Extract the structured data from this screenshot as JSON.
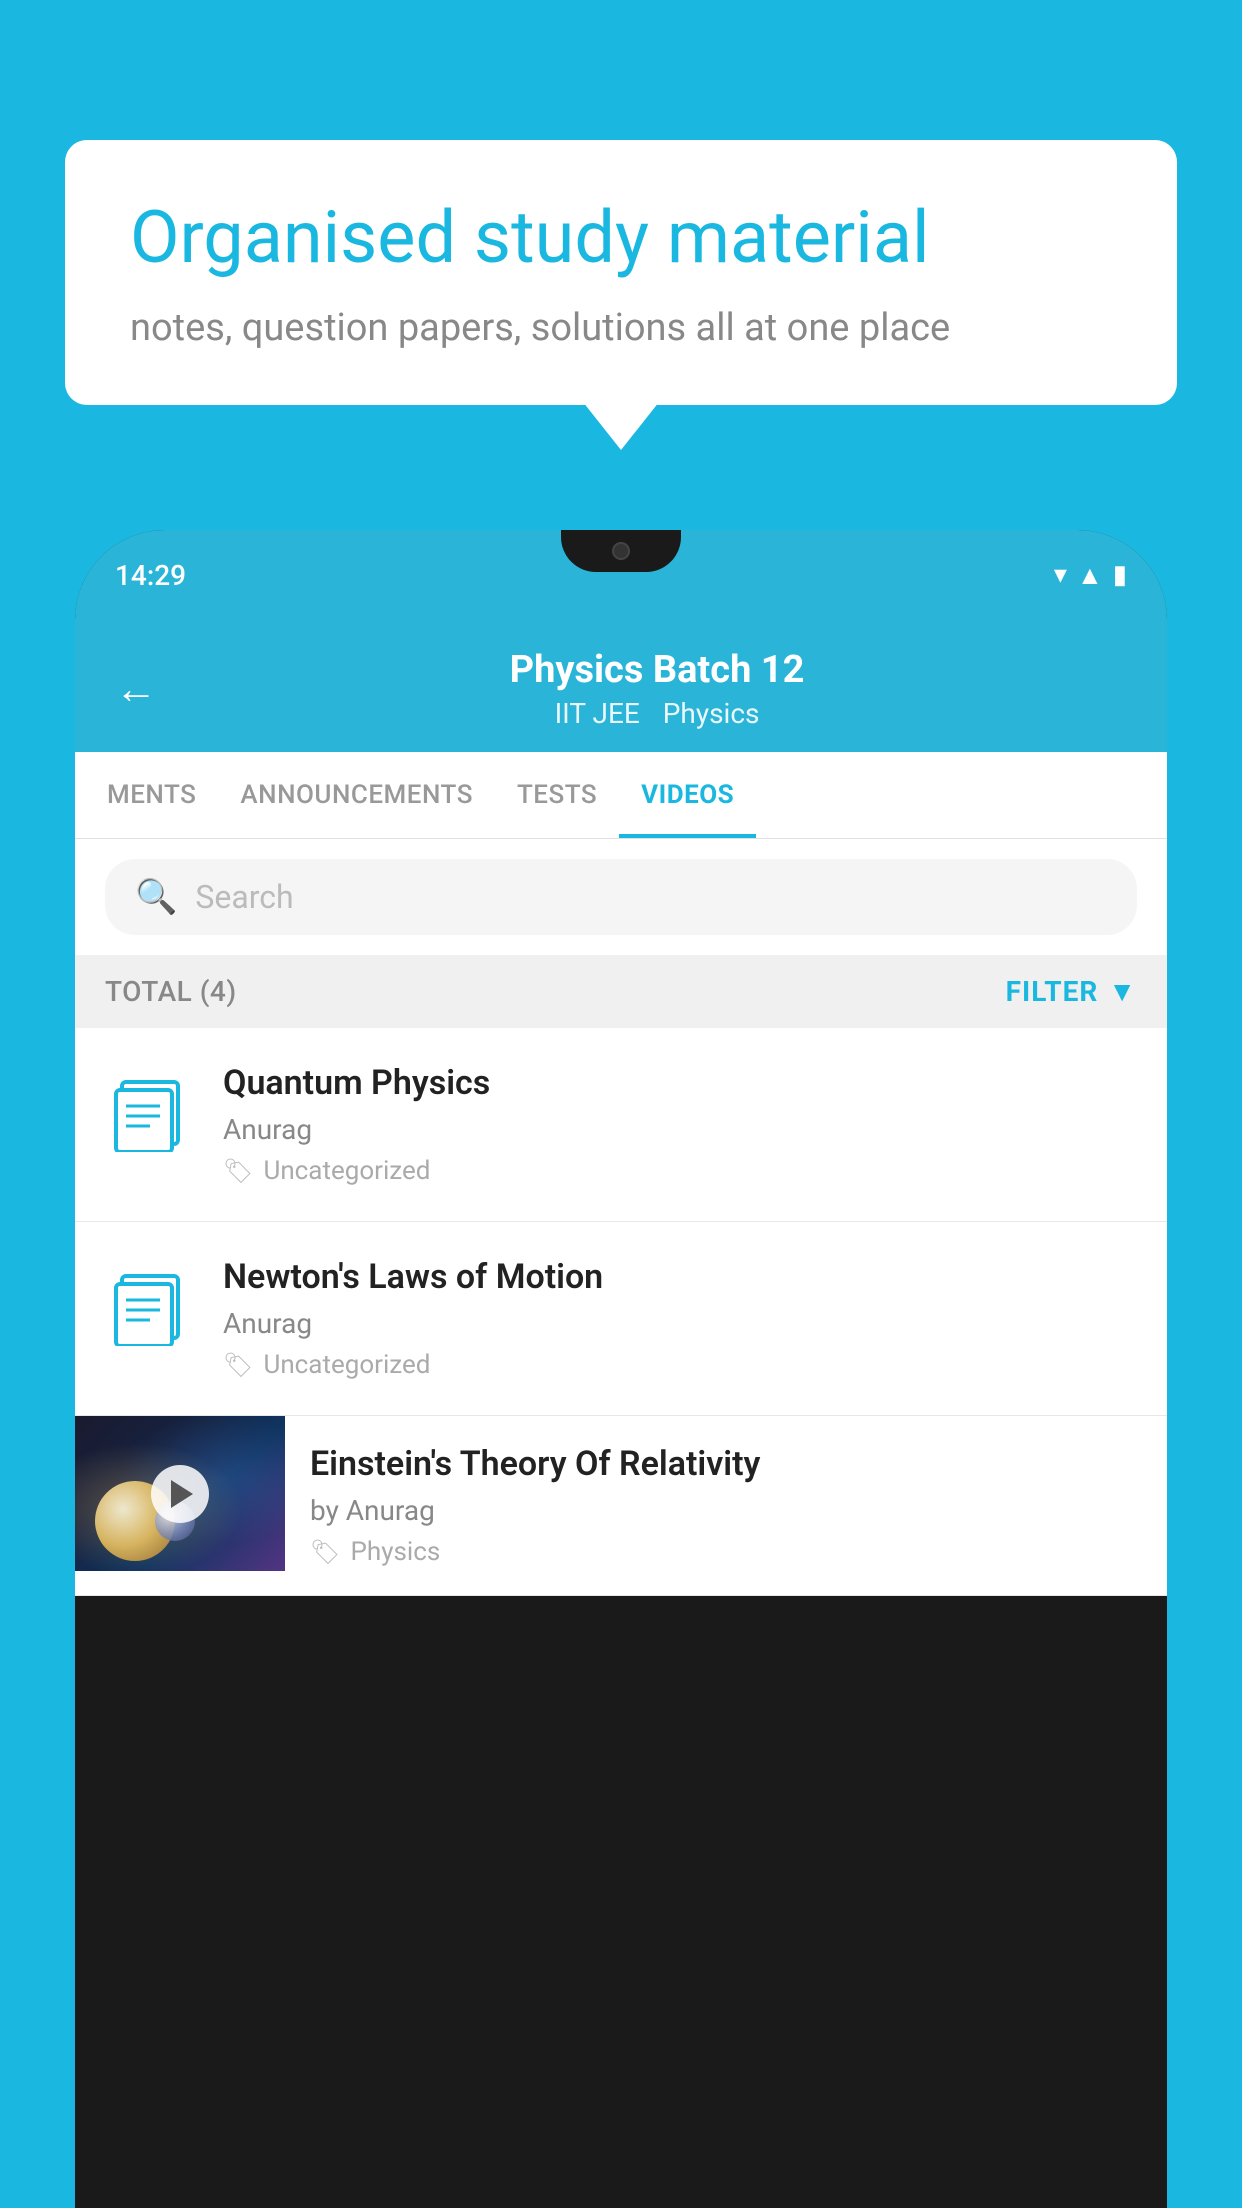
{
  "background_color": "#1ab8e0",
  "speech_bubble": {
    "title": "Organised study material",
    "subtitle": "notes, question papers, solutions all at one place"
  },
  "phone": {
    "status_bar": {
      "time": "14:29"
    },
    "header": {
      "title": "Physics Batch 12",
      "subtitle_left": "IIT JEE",
      "subtitle_right": "Physics",
      "back_label": "←"
    },
    "tabs": [
      {
        "label": "MENTS",
        "active": false
      },
      {
        "label": "ANNOUNCEMENTS",
        "active": false
      },
      {
        "label": "TESTS",
        "active": false
      },
      {
        "label": "VIDEOS",
        "active": true
      }
    ],
    "search": {
      "placeholder": "Search"
    },
    "filter_bar": {
      "total_label": "TOTAL (4)",
      "filter_label": "FILTER"
    },
    "videos": [
      {
        "id": 1,
        "title": "Quantum Physics",
        "author": "Anurag",
        "tag": "Uncategorized",
        "type": "file"
      },
      {
        "id": 2,
        "title": "Newton's Laws of Motion",
        "author": "Anurag",
        "tag": "Uncategorized",
        "type": "file"
      },
      {
        "id": 3,
        "title": "Einstein's Theory Of Relativity",
        "author": "by Anurag",
        "tag": "Physics",
        "type": "video"
      }
    ]
  }
}
